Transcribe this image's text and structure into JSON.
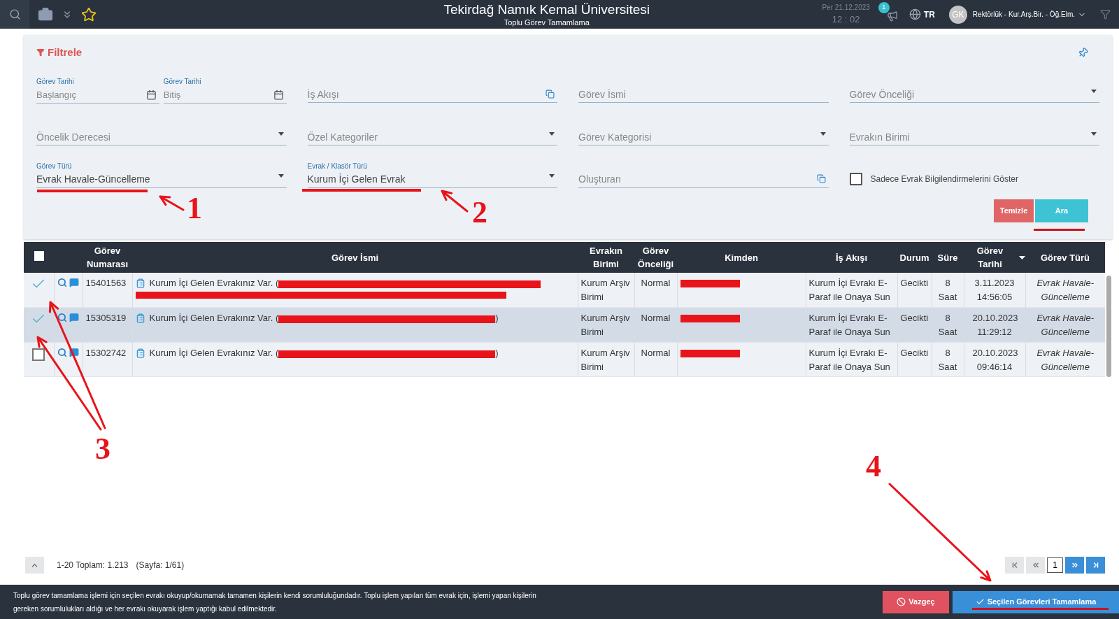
{
  "header": {
    "title": "Tekirdağ Namık Kemal Üniversitesi",
    "subtitle": "Toplu Görev Tamamlama",
    "date": "Per 21.12.2023",
    "time": "12 : 02",
    "notification_count": "1",
    "language": "TR",
    "avatar": "GK",
    "unit": "Rektörlük - Kur.Arş.Bir. - Öğ.Elm."
  },
  "filter": {
    "title": "Filtrele",
    "rows": [
      [
        [
          {
            "kind": "date",
            "label": "Görev Tarihi",
            "placeholder": "Başlangıç"
          },
          {
            "kind": "date",
            "label": "Görev Tarihi",
            "placeholder": "Bitiş"
          }
        ],
        [
          {
            "kind": "lookup",
            "placeholder": "İş Akışı"
          }
        ],
        [
          {
            "kind": "text",
            "placeholder": "Görev İsmi"
          }
        ],
        [
          {
            "kind": "select",
            "placeholder": "Görev Önceliği"
          }
        ]
      ],
      [
        [
          {
            "kind": "select",
            "placeholder": "Öncelik Derecesi"
          }
        ],
        [
          {
            "kind": "select",
            "placeholder": "Özel Kategoriler"
          }
        ],
        [
          {
            "kind": "select",
            "placeholder": "Görev Kategorisi"
          }
        ],
        [
          {
            "kind": "select",
            "placeholder": "Evrakın Birimi"
          }
        ]
      ],
      [
        [
          {
            "kind": "select",
            "label": "Görev Türü",
            "value": "Evrak Havale-Güncelleme"
          }
        ],
        [
          {
            "kind": "select",
            "label": "Evrak / Klasör Türü",
            "value": "Kurum İçi Gelen Evrak"
          }
        ],
        [
          {
            "kind": "lookup",
            "placeholder": "Oluşturan"
          }
        ],
        [
          {
            "kind": "checkbox",
            "label": "Sadece Evrak Bilgilendirmelerini Göster",
            "checked": false
          }
        ]
      ]
    ],
    "buttons": [
      {
        "label": "Temizle",
        "kind": "clear"
      },
      {
        "label": "Ara",
        "kind": "search"
      }
    ]
  },
  "table": {
    "all_checked": false,
    "columns": [
      {
        "label": "Görev Numarası"
      },
      {
        "label": "Görev İsmi"
      },
      {
        "label": "Evrakın Birimi"
      },
      {
        "label": "Görev Önceliği"
      },
      {
        "label": "Kimden"
      },
      {
        "label": "İş Akışı"
      },
      {
        "label": "Durum"
      },
      {
        "label": "Süre"
      },
      {
        "label": "Görev Tarihi",
        "sorted": true
      },
      {
        "label": "Görev Türü"
      }
    ],
    "rows": [
      {
        "checked": true,
        "selected": false,
        "number": "15401563",
        "name": "Kurum İçi Gelen Evrakınız Var. (",
        "unit": "Kurum Arşiv Birimi",
        "priority": "Normal",
        "workflow": "Kurum İçi Evrakı E-Paraf ile Onaya Sun",
        "status": "Gecikti",
        "duration": "8 Saat",
        "date": "3.11.2023 14:56:05",
        "type": "Evrak Havale-Güncelleme"
      },
      {
        "checked": true,
        "selected": true,
        "number": "15305319",
        "name": "Kurum İçi Gelen Evrakınız Var. (",
        "name_end": ")",
        "unit": "Kurum Arşiv Birimi",
        "priority": "Normal",
        "workflow": "Kurum İçi Evrakı E-Paraf ile Onaya Sun",
        "status": "Gecikti",
        "duration": "8 Saat",
        "date": "20.10.2023 11:29:12",
        "type": "Evrak Havale-Güncelleme"
      },
      {
        "checked": false,
        "selected": false,
        "number": "15302742",
        "name": "Kurum İçi Gelen Evrakınız Var. (",
        "name_end": ")",
        "unit": "Kurum Arşiv Birimi",
        "priority": "Normal",
        "workflow": "Kurum İçi Evrakı E-Paraf ile Onaya Sun",
        "status": "Gecikti",
        "duration": "8 Saat",
        "date": "20.10.2023 09:46:14",
        "type": "Evrak Havale-Güncelleme"
      }
    ]
  },
  "pagination": {
    "summary": "1-20 Toplam: 1.213",
    "page_info": "(Sayfa: 1/61)",
    "page": "1",
    "buttons": [
      {
        "kind": "first",
        "disabled": true
      },
      {
        "kind": "prev",
        "disabled": true
      },
      {
        "kind": "next",
        "disabled": false
      },
      {
        "kind": "last",
        "disabled": false
      }
    ]
  },
  "footer": {
    "notice": "Toplu görev tamamlama işlemi için seçilen evrakı okuyup/okumamak tamamen kişilerin kendi sorumluluğundadır. Toplu işlem yapılan tüm evrak için, işlemi yapan kişilerin gereken sorumlulukları aldığı ve her evrakı okuyarak işlem yaptığı kabul edilmektedir.",
    "buttons": [
      {
        "kind": "cancel",
        "label": "Vazgeç"
      },
      {
        "kind": "confirm",
        "label": "Seçilen Görevleri Tamamlama"
      }
    ]
  },
  "annotations": [
    {
      "label": "1"
    },
    {
      "label": "2"
    },
    {
      "label": "3"
    },
    {
      "label": "4"
    }
  ]
}
